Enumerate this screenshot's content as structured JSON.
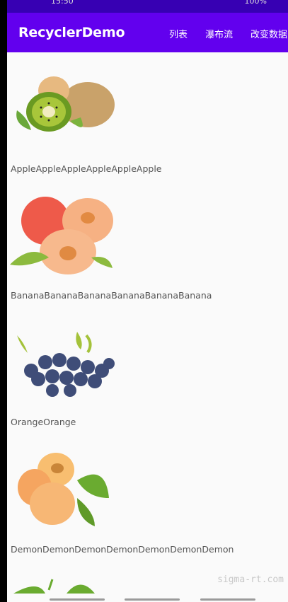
{
  "status": {
    "time": "15:50",
    "right": "100%"
  },
  "app_bar": {
    "title": "RecyclerDemo",
    "menu": [
      "列表",
      "瀑布流",
      "改变数据"
    ]
  },
  "items": [
    {
      "label": "AppleAppleAppleAppleAppleApple",
      "image": "kiwi-fruit-image"
    },
    {
      "label": "BananaBananaBananaBananaBananaBanana",
      "image": "peach-fruit-image"
    },
    {
      "label": "OrangeOrange",
      "image": "blueberry-fruit-image"
    },
    {
      "label": "DemonDemonDemonDemonDemonDemonDemon",
      "image": "apricot-fruit-image"
    }
  ],
  "watermark": "sigma-rt.com"
}
